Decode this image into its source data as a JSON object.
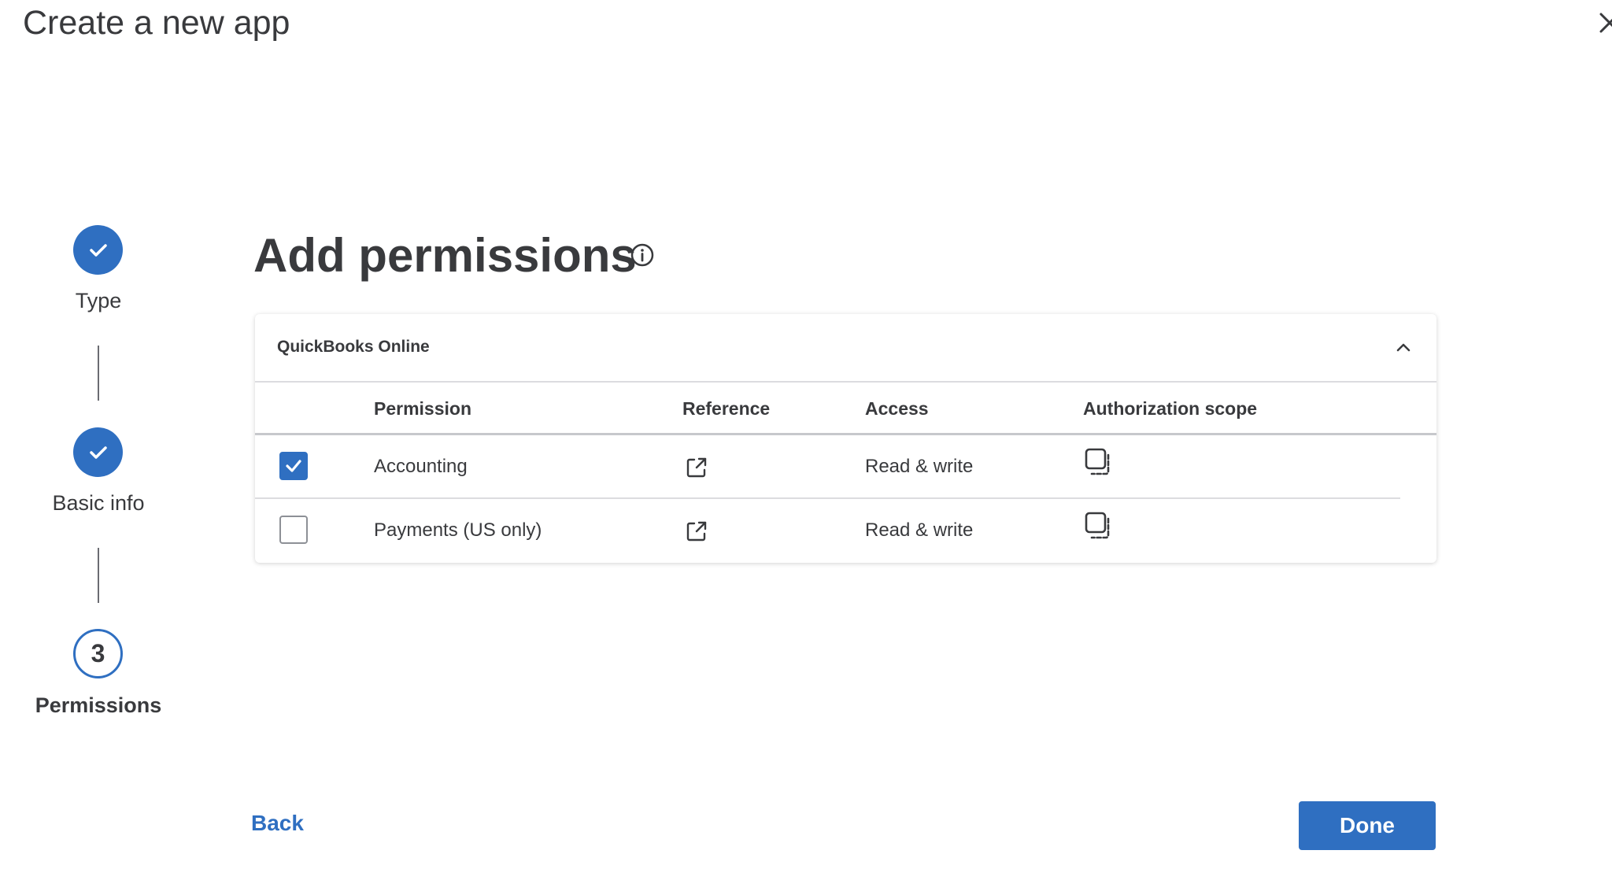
{
  "window": {
    "title": "Create a new app",
    "close_icon": "close-icon"
  },
  "stepper": {
    "steps": [
      {
        "label": "Type",
        "state": "complete",
        "icon": "checkmark-icon"
      },
      {
        "label": "Basic info",
        "state": "complete",
        "icon": "checkmark-icon"
      },
      {
        "label": "Permissions",
        "state": "current",
        "number": "3"
      }
    ]
  },
  "main": {
    "title": "Add permissions",
    "info_icon": "info-icon"
  },
  "permissions_card": {
    "header": "QuickBooks Online",
    "expanded": true,
    "columns": {
      "permission": "Permission",
      "reference": "Reference",
      "access": "Access",
      "scope": "Authorization scope"
    },
    "rows": [
      {
        "checked": true,
        "permission": "Accounting",
        "access": "Read & write"
      },
      {
        "checked": false,
        "permission": "Payments (US only)",
        "access": "Read & write"
      }
    ]
  },
  "footer": {
    "back_label": "Back",
    "done_label": "Done"
  },
  "colors": {
    "accent": "#2f6fc1",
    "text": "#393a3d",
    "divider": "#dcdcdf"
  }
}
